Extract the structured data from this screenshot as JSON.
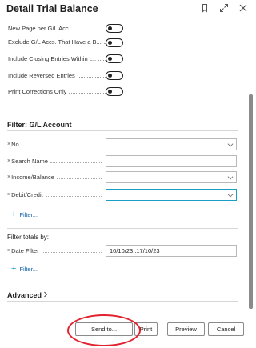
{
  "header": {
    "title": "Detail Trial Balance"
  },
  "options": [
    {
      "label": "New Page per G/L Acc."
    },
    {
      "label": "Exclude G/L Accs. That Have a B..."
    },
    {
      "label": "Include Closing Entries Within t..."
    },
    {
      "label": "Include Reversed Entries"
    },
    {
      "label": "Print Corrections Only"
    }
  ],
  "filter_gl": {
    "title": "Filter: G/L Account",
    "fields": [
      {
        "label": "No.",
        "value": ""
      },
      {
        "label": "Search Name",
        "value": ""
      },
      {
        "label": "Income/Balance",
        "value": ""
      },
      {
        "label": "Debit/Credit",
        "value": ""
      }
    ],
    "add_filter": "Filter..."
  },
  "filter_totals": {
    "title": "Filter totals by:",
    "fields": [
      {
        "label": "Date Filter",
        "value": "10/10/23..17/10/23"
      }
    ],
    "add_filter": "Filter..."
  },
  "advanced": {
    "label": "Advanced"
  },
  "buttons": {
    "send_to": "Send to...",
    "print": "Print",
    "preview": "Preview",
    "cancel": "Cancel"
  },
  "colors": {
    "accent": "#1a9ec6",
    "link": "#1460a8",
    "highlight_circle": "#e0232e"
  }
}
